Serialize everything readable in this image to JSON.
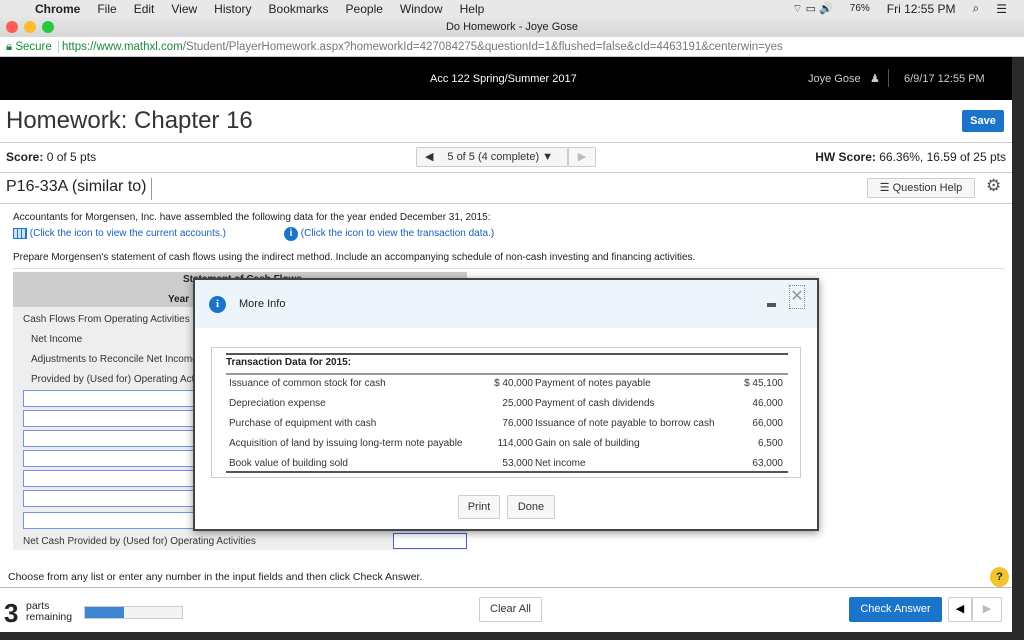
{
  "menubar": {
    "app": "Chrome",
    "items": [
      "File",
      "Edit",
      "View",
      "History",
      "Bookmarks",
      "People",
      "Window",
      "Help"
    ],
    "battery": "76%",
    "clock": "Fri 12:55 PM"
  },
  "window": {
    "title": "Do Homework - Joye Gose"
  },
  "address": {
    "secure": "Secure",
    "url_host": "https://www.mathxl.com",
    "url_path": "/Student/PlayerHomework.aspx?homeworkId=427084275&questionId=1&flushed=false&cId=4463191&centerwin=yes"
  },
  "header": {
    "course": "Acc 122 Spring/Summer 2017",
    "user": "Joye Gose",
    "datetime": "6/9/17 12:55 PM"
  },
  "homework": {
    "title": "Homework: Chapter 16",
    "save": "Save",
    "score_label": "Score:",
    "score": "0 of 5 pts",
    "question_nav": "5 of 5 (4 complete)",
    "hw_score_label": "HW Score:",
    "hw_score": "66.36%, 16.59 of 25 pts",
    "question_id": "P16-33A (similar to)",
    "question_help": "Question Help"
  },
  "question": {
    "intro": "Accountants for Morgensen, Inc. have assembled the following data for the year ended December 31, 2015:",
    "link_accounts": "(Click the icon to view the current accounts.)",
    "link_transactions": "(Click the icon to view the transaction data.)",
    "prompt": "Prepare Morgensen's statement of cash flows using the indirect method. Include an accompanying schedule of non-cash investing and financing activities."
  },
  "statement": {
    "title": "Statement of Cash Flows",
    "year": "Year",
    "rows": [
      "Cash Flows From Operating Activities",
      "Net Income",
      "Adjustments to Reconcile Net Income",
      "Provided by (Used for) Operating Activities"
    ],
    "net_cash": "Net Cash Provided by (Used for) Operating Activities"
  },
  "modal": {
    "title": "More Info",
    "table_title": "Transaction Data for 2015:",
    "rows": [
      {
        "l": "Issuance of common stock for cash",
        "lv": "$  40,000",
        "r": "Payment of notes payable",
        "rv": "$ 45,100"
      },
      {
        "l": "Depreciation expense",
        "lv": "25,000",
        "r": "Payment of cash dividends",
        "rv": "46,000"
      },
      {
        "l": "Purchase of equipment with cash",
        "lv": "76,000",
        "r": "Issuance of note payable to borrow cash",
        "rv": "66,000"
      },
      {
        "l": "Acquisition of land by issuing long-term note payable",
        "lv": "114,000",
        "r": "Gain on sale of building",
        "rv": "6,500"
      },
      {
        "l": "Book value of building sold",
        "lv": "53,000",
        "r": "Net income",
        "rv": "63,000"
      }
    ],
    "print": "Print",
    "done": "Done"
  },
  "footer": {
    "instructions": "Choose from any list or enter any number in the input fields and then click Check Answer.",
    "parts_count": "3",
    "parts_label1": "parts",
    "parts_label2": "remaining",
    "progress_percent": 40,
    "clear_all": "Clear All",
    "check_answer": "Check Answer"
  },
  "colors": {
    "accent": "#1a74c9",
    "link": "#1a5fb4"
  }
}
